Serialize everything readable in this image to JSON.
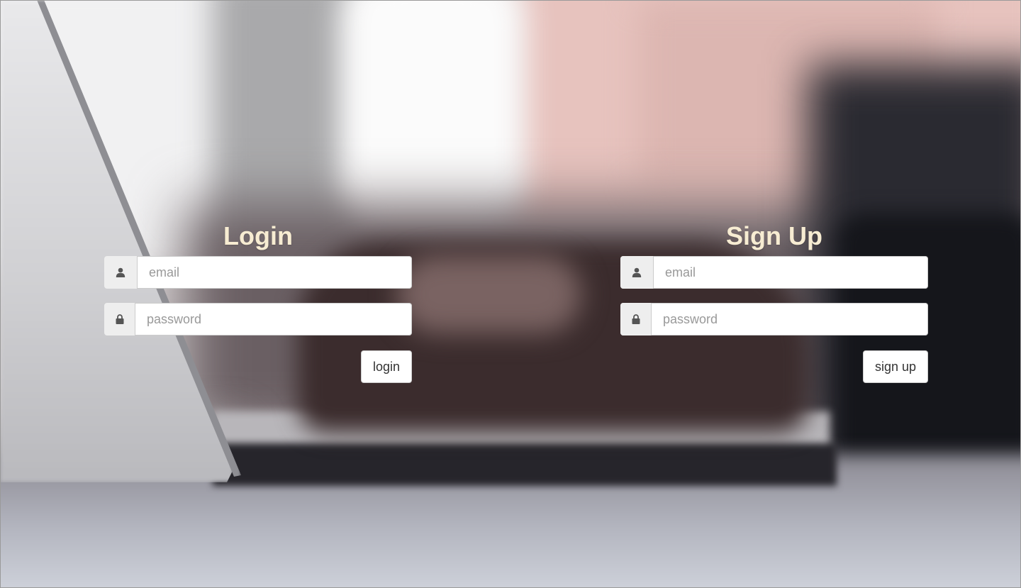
{
  "login": {
    "title": "Login",
    "email": {
      "icon": "user-icon",
      "placeholder": "email",
      "value": ""
    },
    "password": {
      "icon": "lock-icon",
      "placeholder": "password",
      "value": ""
    },
    "button_label": "login"
  },
  "signup": {
    "title": "Sign Up",
    "email": {
      "icon": "user-icon",
      "placeholder": "email",
      "value": ""
    },
    "password": {
      "icon": "lock-icon",
      "placeholder": "password",
      "value": ""
    },
    "button_label": "sign up"
  },
  "colors": {
    "title_text": "#f7ecd2",
    "addon_bg": "#eeeeee",
    "icon": "#555555",
    "border": "#cccccc"
  }
}
